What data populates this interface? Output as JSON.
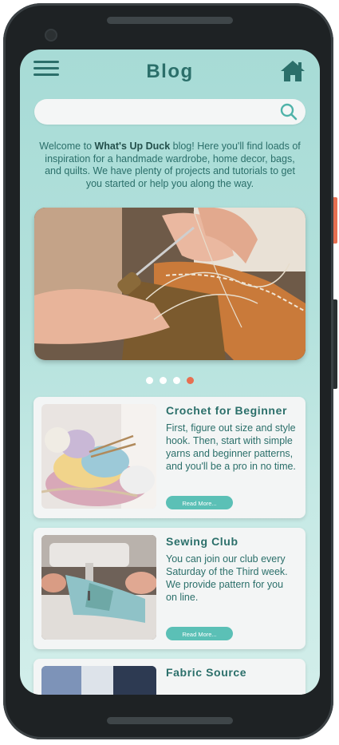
{
  "header": {
    "title": "Blog"
  },
  "search": {
    "placeholder": "",
    "value": ""
  },
  "intro": {
    "prefix": "Welcome to ",
    "brand": "What's Up Duck",
    "suffix": " blog! Here you'll find loads of inspiration for a handmade wardrobe, home decor, bags, and quilts. We have plenty of projects and tutorials to get you started or help you along the way."
  },
  "carousel": {
    "total": 4,
    "active_index": 3
  },
  "cards": [
    {
      "title": "Crochet for Beginner",
      "description": "First, figure out size and style hook. Then, start with simple yarns and beginner patterns, and you'll be a pro in no time.",
      "button": "Read More..."
    },
    {
      "title": "Sewing Club",
      "description": "You can join our club every Saturday of the Third week. We provide pattern for you on line.",
      "button": "Read More..."
    },
    {
      "title": "Fabric Source",
      "description": "",
      "button": ""
    }
  ],
  "colors": {
    "primary": "#2b6f6a",
    "accent": "#e76f51",
    "button": "#5bc0b6",
    "background": "#a7dbd6"
  },
  "icons": {
    "menu": "hamburger-icon",
    "home": "home-icon",
    "search": "search-icon"
  }
}
